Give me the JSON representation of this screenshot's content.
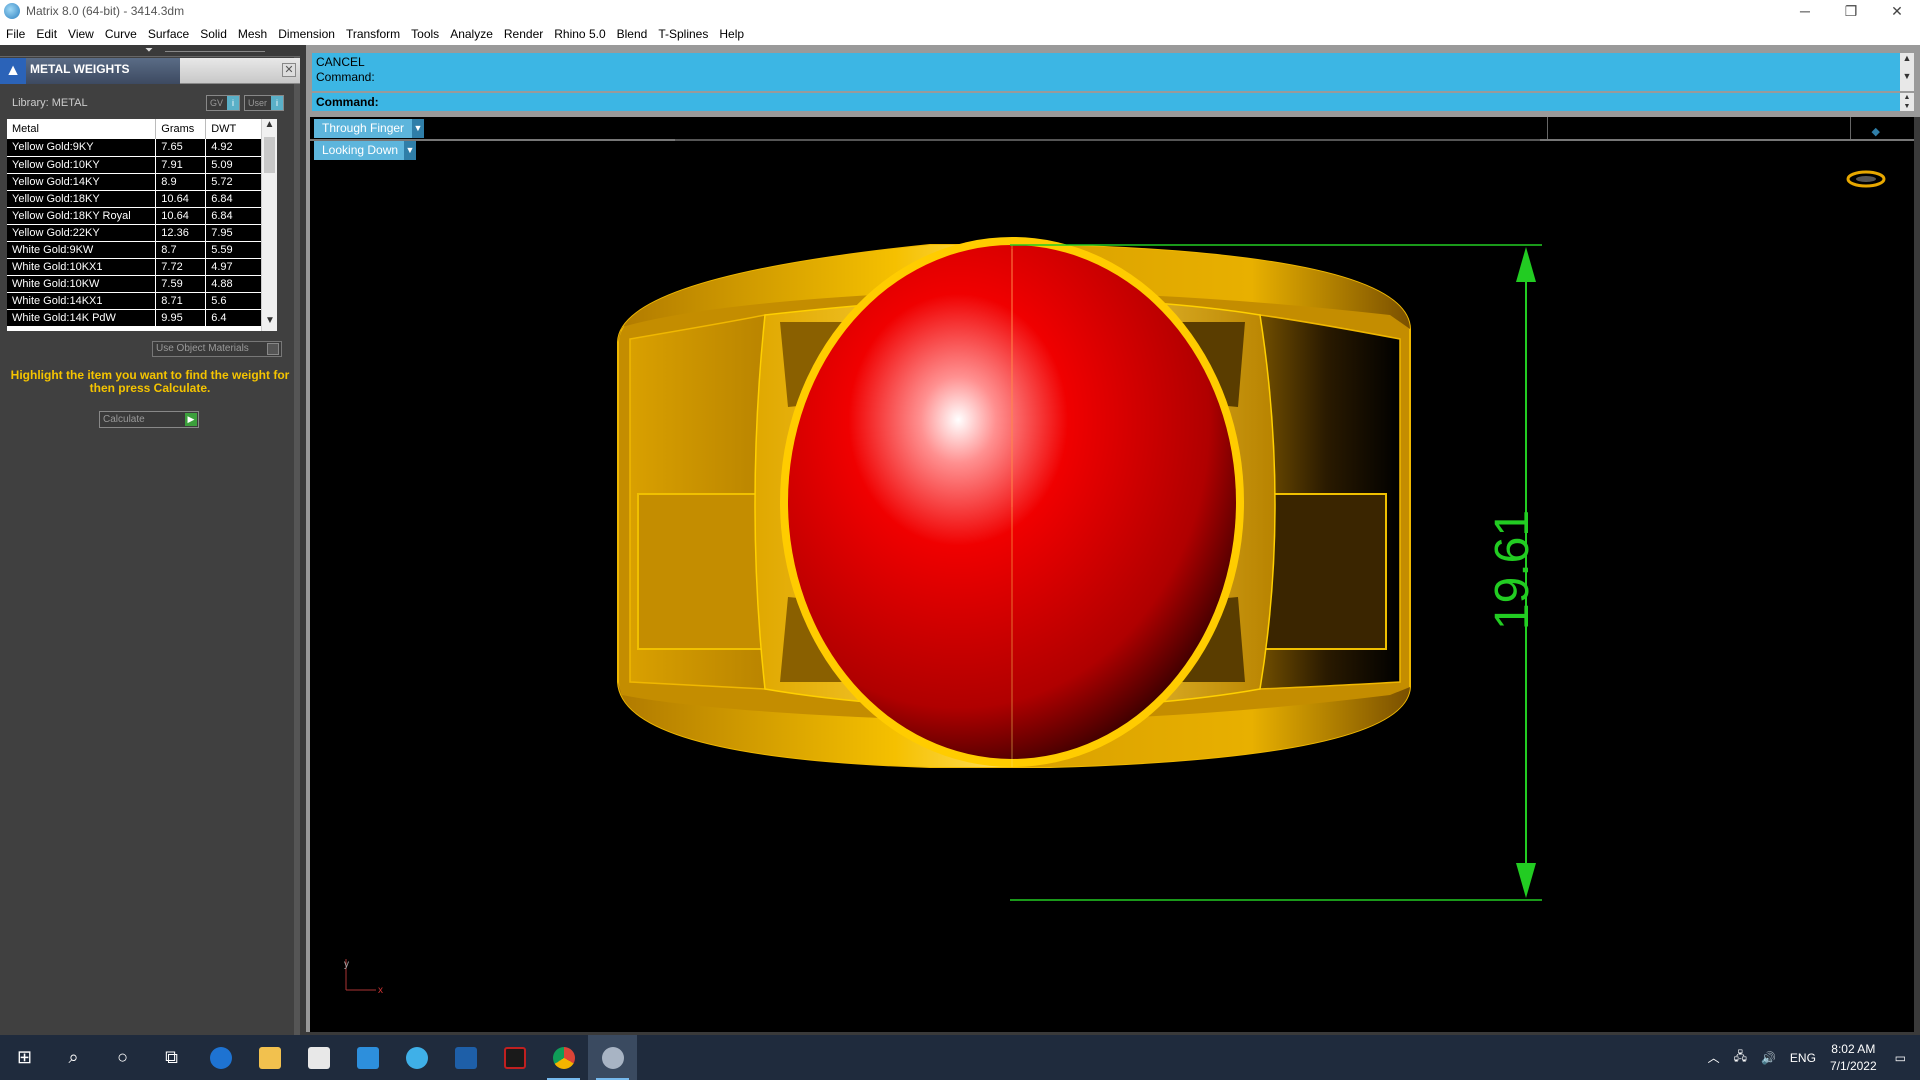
{
  "window": {
    "title": "Matrix 8.0 (64-bit) - 3414.3dm",
    "controls": [
      "─",
      "❐",
      "✕"
    ]
  },
  "menu": [
    "File",
    "Edit",
    "View",
    "Curve",
    "Surface",
    "Solid",
    "Mesh",
    "Dimension",
    "Transform",
    "Tools",
    "Analyze",
    "Render",
    "Rhino 5.0",
    "Blend",
    "T-Splines",
    "Help"
  ],
  "panel": {
    "title": "METAL WEIGHTS",
    "close": "✕",
    "library_label": "Library: METAL",
    "btn_gv": "GV",
    "btn_user": "User",
    "columns": [
      "Metal",
      "Grams",
      "DWT"
    ],
    "rows": [
      [
        "Yellow Gold:9KY",
        "7.65",
        "4.92"
      ],
      [
        "Yellow Gold:10KY",
        "7.91",
        "5.09"
      ],
      [
        "Yellow Gold:14KY",
        "8.9",
        "5.72"
      ],
      [
        "Yellow Gold:18KY",
        "10.64",
        "6.84"
      ],
      [
        "Yellow Gold:18KY Royal",
        "10.64",
        "6.84"
      ],
      [
        "Yellow Gold:22KY",
        "12.36",
        "7.95"
      ],
      [
        "White Gold:9KW",
        "8.7",
        "5.59"
      ],
      [
        "White Gold:10KX1",
        "7.72",
        "4.97"
      ],
      [
        "White Gold:10KW",
        "7.59",
        "4.88"
      ],
      [
        "White Gold:14KX1",
        "8.71",
        "5.6"
      ],
      [
        "White Gold:14K PdW",
        "9.95",
        "6.4"
      ]
    ],
    "use_object_materials": "Use Object Materials",
    "hint": "Highlight the item you want to find the weight for then press Calculate.",
    "calculate": "Calculate"
  },
  "command": {
    "history_1": "CANCEL",
    "history_2": "Command:",
    "prompt": "Command:"
  },
  "viewport": {
    "view_mode_1": "Through Finger",
    "view_mode_2": "Looking Down",
    "dimension_value": "19.61",
    "axis_y": "y",
    "axis_x": "x"
  },
  "taskbar": {
    "language": "ENG",
    "time": "8:02 AM",
    "date": "7/1/2022"
  },
  "colors": {
    "command_bg": "#3cb6e4",
    "view_dropdown": "#5db5dc",
    "hint_text": "#f5c400",
    "dimension_green": "#22cc22",
    "gem_red": "#e00000",
    "gold": "#f0b800"
  }
}
